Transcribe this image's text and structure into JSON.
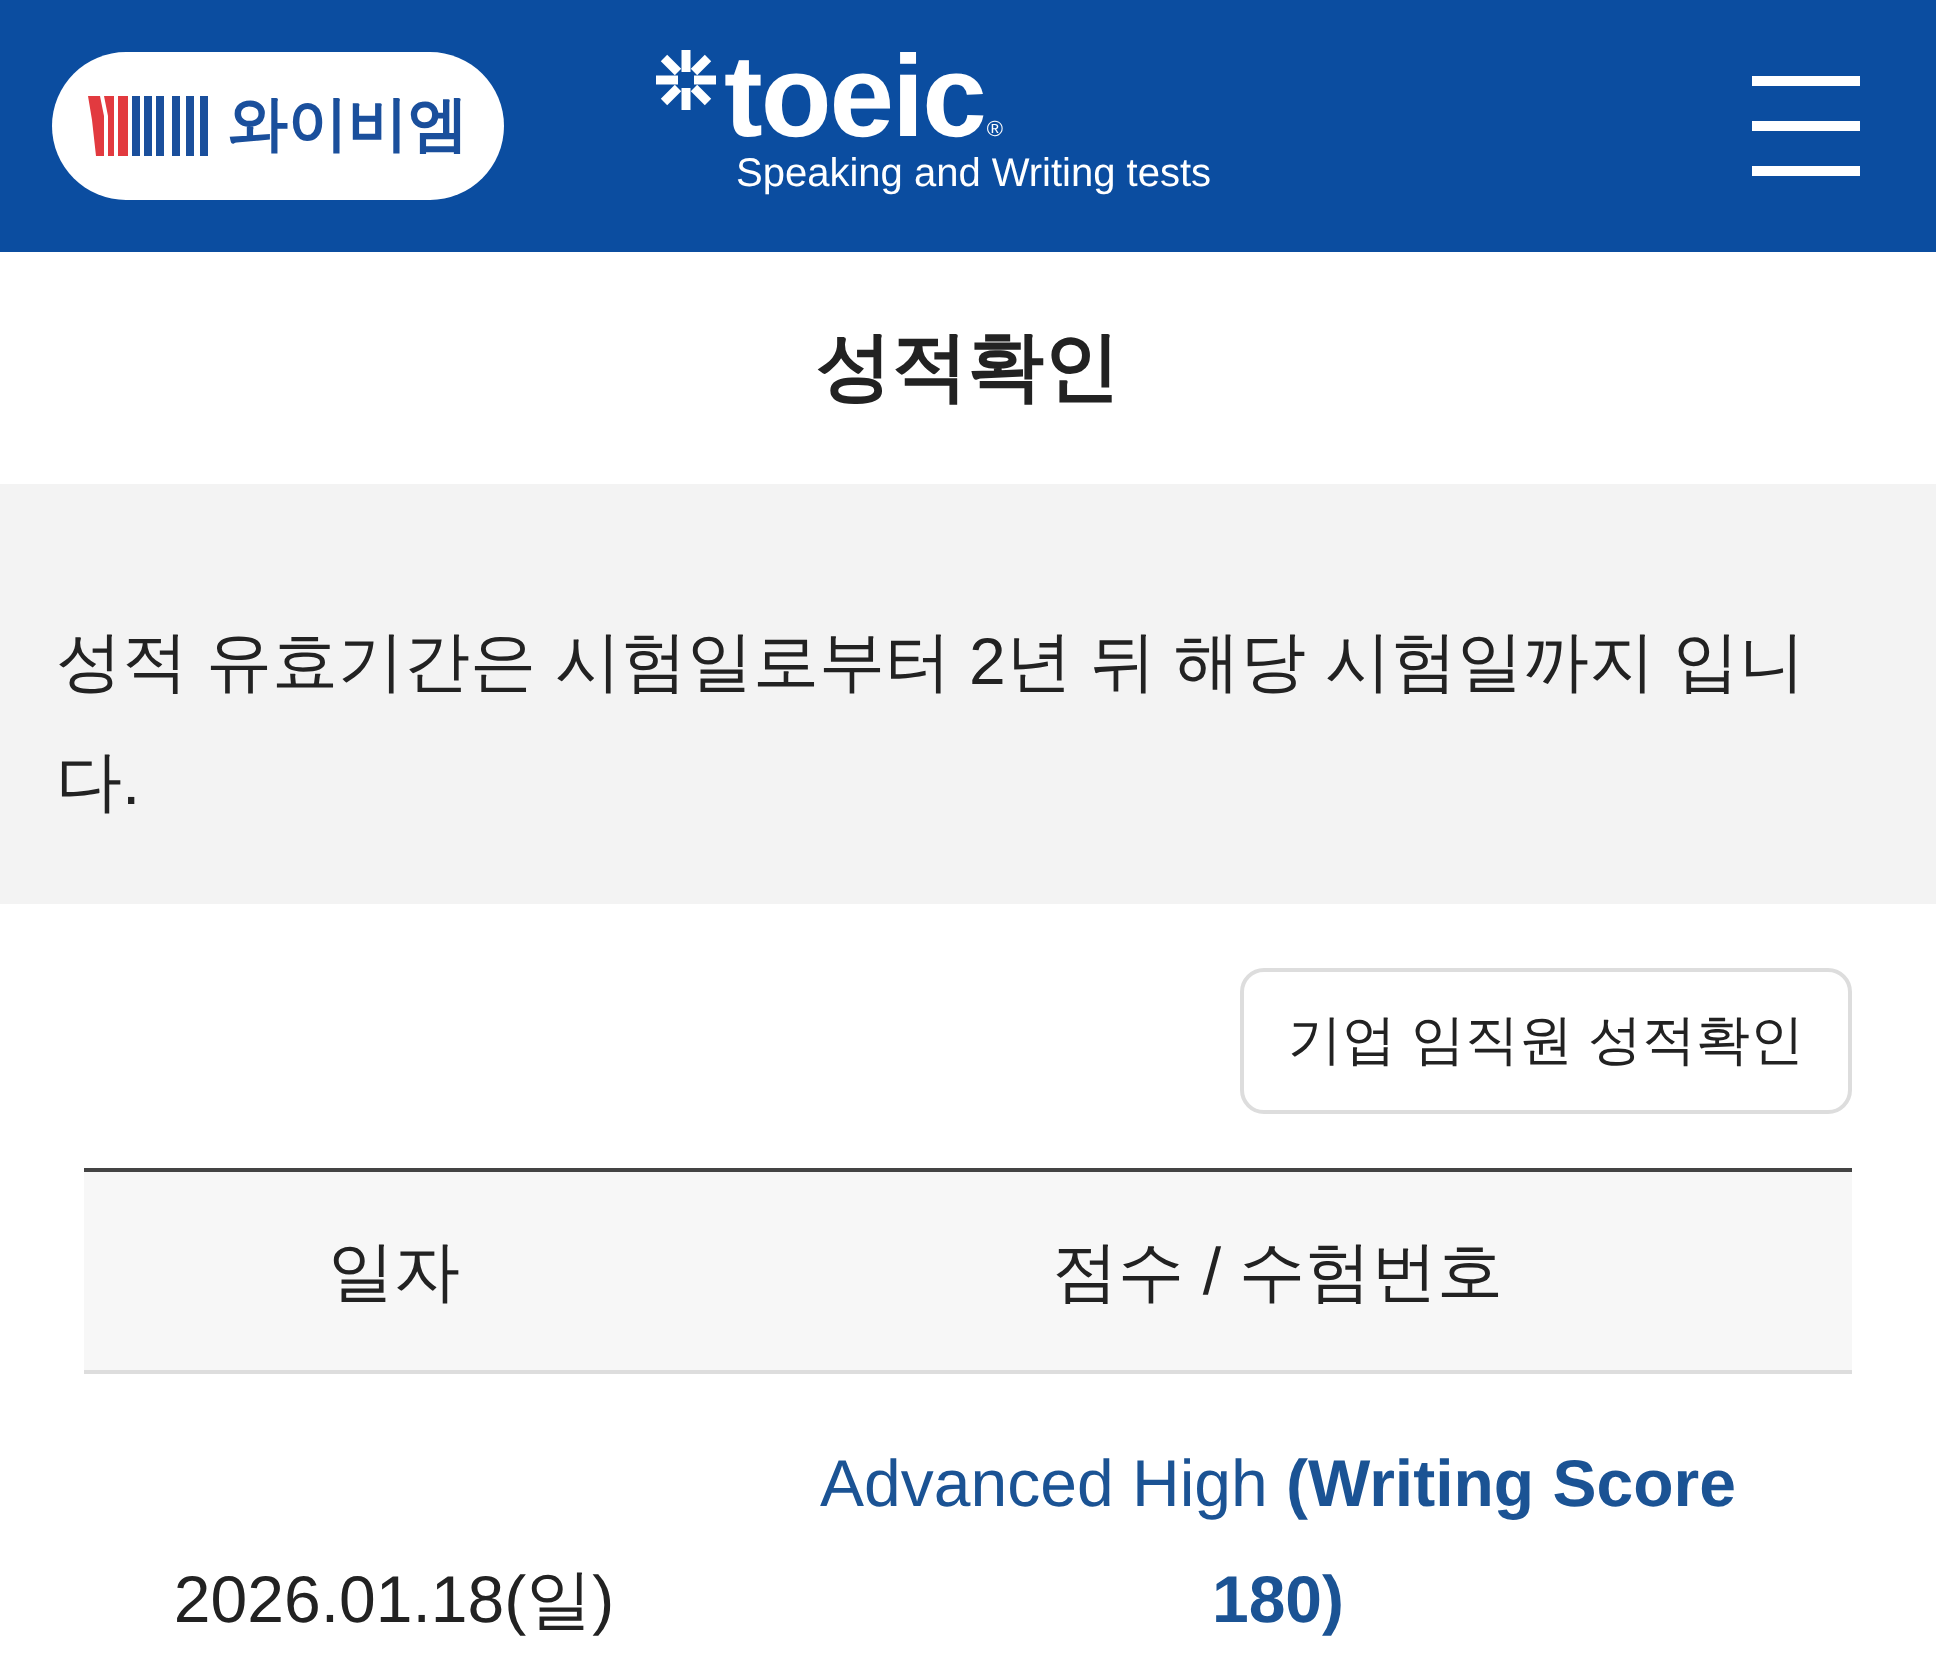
{
  "header": {
    "logo_text": "와이비엠",
    "brand_name": "toeic",
    "registered_mark": "®",
    "tagline": "Speaking and Writing tests"
  },
  "page_title": "성적확인",
  "notice": "성적 유효기간은 시험일로부터 2년 뒤 해당 시험일까지 입니다.",
  "corporate_button": "기업 임직원 성적확인",
  "table": {
    "columns": [
      "일자",
      "점수 / 수험번호"
    ],
    "rows": [
      {
        "date": "2026.01.18(일)",
        "score": "Advanced High **(Writing Score 180)**"
      }
    ]
  }
}
